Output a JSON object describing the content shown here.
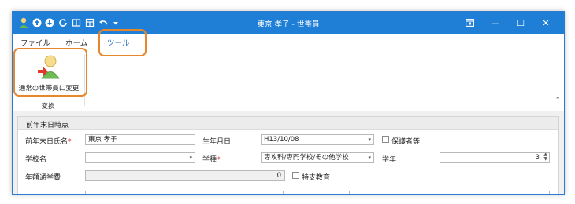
{
  "window": {
    "title": "東京 孝子 - 世帯員",
    "controls": {
      "help_icon": "help-window-icon",
      "restore": "❐",
      "minimize": "—",
      "maximize": "☐",
      "close": "✕"
    }
  },
  "menu": {
    "items": [
      "ファイル",
      "ホーム",
      "ツール"
    ],
    "active_index": 2
  },
  "ribbon": {
    "button_label": "通常の世帯員に変更",
    "group_label": "変換",
    "collapse_glyph": "⌃"
  },
  "section": {
    "title": "前年末日時点",
    "fields": {
      "name_label": "前年末日氏名",
      "name_value": "東京 孝子",
      "birth_label": "生年月日",
      "birth_value": "H13/10/08",
      "guardian_label": "保護者等",
      "school_label": "学校名",
      "school_value": "",
      "school_type_label": "学種",
      "school_type_value": "専攻科/専門学校/その他学校",
      "grade_label": "学年",
      "grade_value": "3",
      "tuition_label": "年額通学費",
      "tuition_value": "0",
      "special_label": "特支教育"
    },
    "required_mark": "*"
  },
  "colors": {
    "title_bar": "#1f7fd6",
    "highlight": "#e8862c",
    "accent": "#1f6fc0",
    "required": "#d01010"
  }
}
